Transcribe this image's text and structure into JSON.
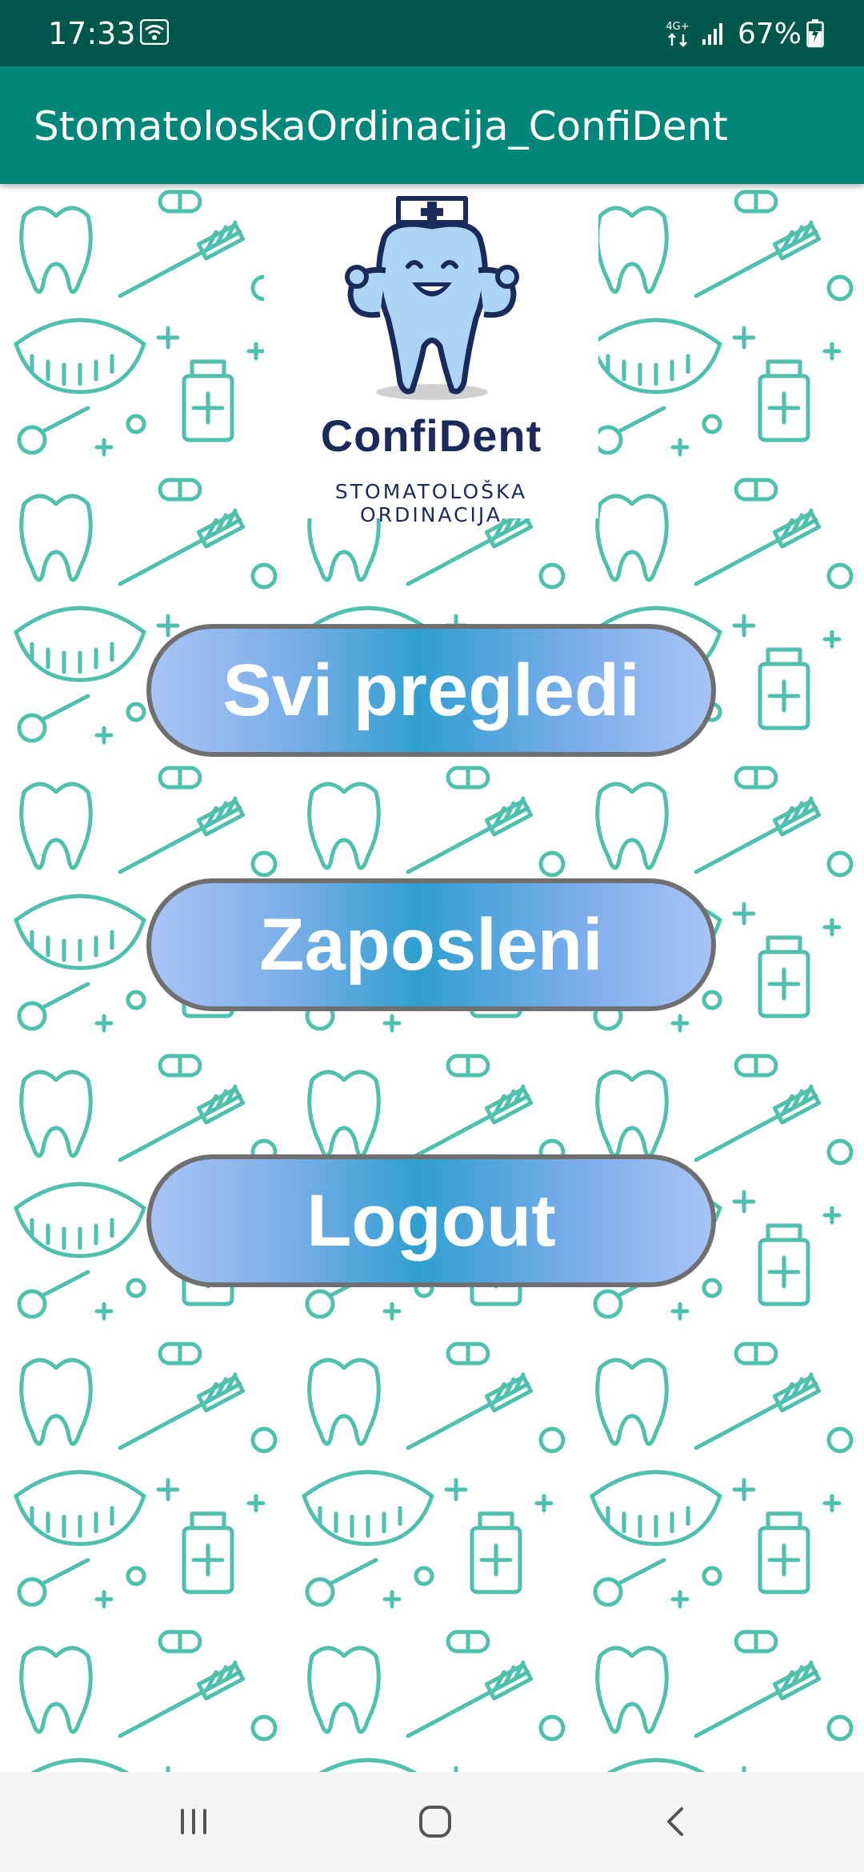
{
  "status_bar": {
    "time": "17:33",
    "network": "4G+",
    "battery": "67%",
    "icons": [
      "wifi-icon",
      "network-4g-icon",
      "signal-icon",
      "battery-charging-icon"
    ]
  },
  "app_bar": {
    "title": "StomatoloskaOrdinacija_ConfiDent",
    "color": "#00877a",
    "status_color": "#00574b"
  },
  "logo": {
    "name": "ConfiDent",
    "subtitle": "STOMATOLOŠKA ORDINACIJA"
  },
  "menu": {
    "buttons": [
      {
        "label": "Svi pregledi"
      },
      {
        "label": "Zaposleni"
      },
      {
        "label": "Logout"
      }
    ]
  },
  "nav_bar": {
    "icons": [
      "recents-icon",
      "home-icon",
      "back-icon"
    ]
  },
  "colors": {
    "pattern": "#4fbfae",
    "button_center": "#2f9fd0",
    "button_edge": "#a9c4f5",
    "logo_text": "#1a2a5a"
  }
}
